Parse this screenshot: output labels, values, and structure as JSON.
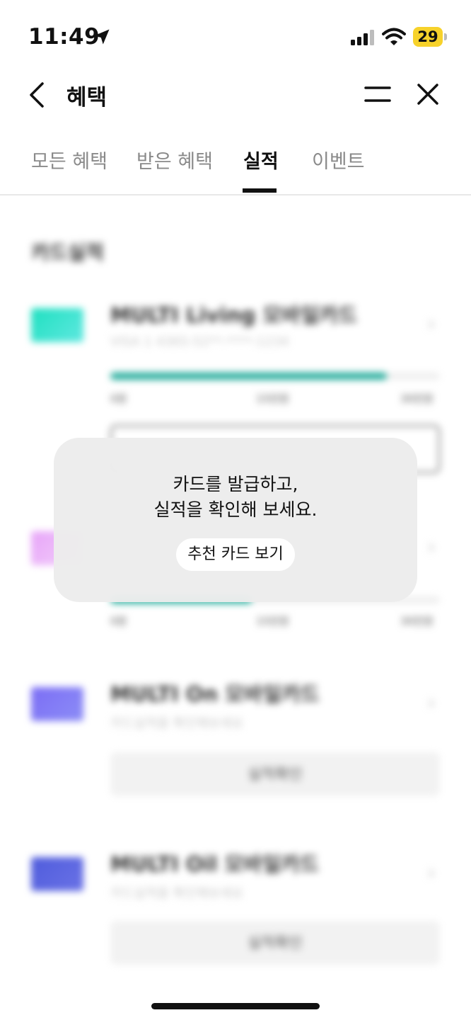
{
  "status_bar": {
    "time": "11:49",
    "battery": "29"
  },
  "header": {
    "title": "혜택"
  },
  "tabs": [
    {
      "label": "모든 혜택",
      "active": false
    },
    {
      "label": "받은 혜택",
      "active": false
    },
    {
      "label": "실적",
      "active": true
    },
    {
      "label": "이벤트",
      "active": false
    }
  ],
  "content": {
    "section_title": "카드실적",
    "cards": [
      {
        "name": "MULTI Living 모바일카드",
        "sub": "VISA 1 4365-52**-****-1234",
        "progress": 0.84,
        "ticks": [
          "0원",
          "15만원",
          "30만원"
        ],
        "colors": [
          "#1fe0c0",
          "#5fe8e0"
        ]
      },
      {
        "name": "",
        "sub": "",
        "progress": 0.43,
        "ticks": [
          "0원",
          "15만원",
          "30만원"
        ],
        "colors": [
          "#e7a4f8",
          "#f3d1fb"
        ]
      },
      {
        "name": "MULTI On 모바일카드",
        "sub": "카드실적을 확인해보세요",
        "button": "실적확인",
        "colors": [
          "#7b6df5",
          "#8c8df6"
        ]
      },
      {
        "name": "MULTI Oil 모바일카드",
        "sub": "카드실적을 확인해보세요",
        "button": "실적확인",
        "colors": [
          "#4f5cdc",
          "#6a72e6"
        ]
      }
    ]
  },
  "popup": {
    "line1": "카드를 발급하고,",
    "line2": "실적을 확인해 보세요.",
    "button": "추천 카드 보기"
  }
}
